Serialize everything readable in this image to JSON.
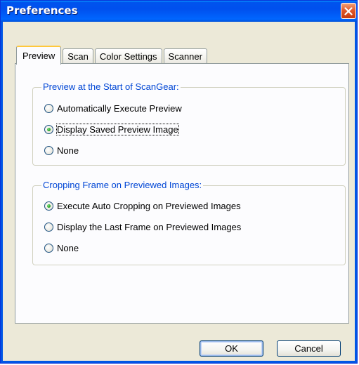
{
  "window": {
    "title": "Preferences"
  },
  "tabs": [
    {
      "label": "Preview",
      "active": true
    },
    {
      "label": "Scan",
      "active": false
    },
    {
      "label": "Color Settings",
      "active": false
    },
    {
      "label": "Scanner",
      "active": false
    }
  ],
  "groups": {
    "preview_start": {
      "legend": "Preview at the Start of ScanGear:",
      "options": [
        {
          "label": "Automatically Execute Preview",
          "checked": false
        },
        {
          "label": "Display Saved Preview Image",
          "checked": true
        },
        {
          "label": "None",
          "checked": false
        }
      ]
    },
    "cropping_frame": {
      "legend": "Cropping Frame on Previewed Images:",
      "options": [
        {
          "label": "Execute Auto Cropping on Previewed Images",
          "checked": true
        },
        {
          "label": "Display the Last Frame on Previewed Images",
          "checked": false
        },
        {
          "label": "None",
          "checked": false
        }
      ]
    }
  },
  "buttons": {
    "ok_label": "OK",
    "cancel_label": "Cancel"
  },
  "icons": {
    "close": "close-icon"
  },
  "colors": {
    "titlebar": "#0055e5",
    "legend_text": "#0046d5",
    "dialog_bg": "#ece9d8",
    "panel_bg": "#fcfcfe",
    "close_button": "#e2592a"
  }
}
